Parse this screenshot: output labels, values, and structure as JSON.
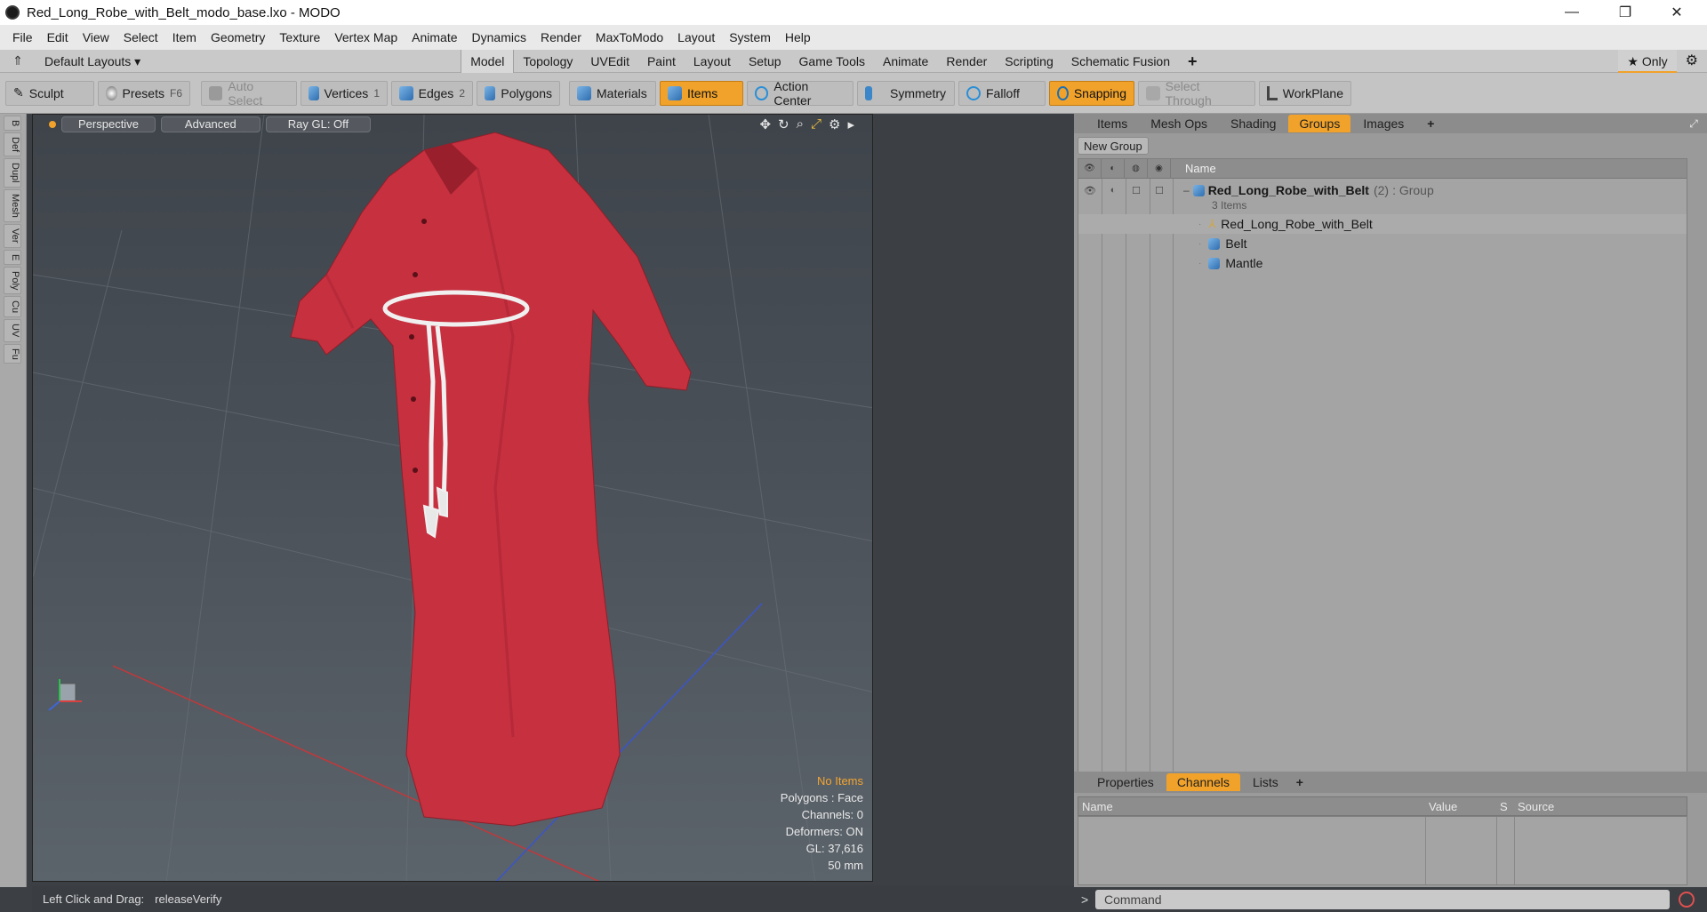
{
  "window": {
    "title": "Red_Long_Robe_with_Belt_modo_base.lxo - MODO",
    "minimize_glyph": "—",
    "restore_glyph": "❐",
    "close_glyph": "✕"
  },
  "menu": [
    "File",
    "Edit",
    "View",
    "Select",
    "Item",
    "Geometry",
    "Texture",
    "Vertex Map",
    "Animate",
    "Dynamics",
    "Render",
    "MaxToModo",
    "Layout",
    "System",
    "Help"
  ],
  "layoutbar": {
    "layouts_label": "Default Layouts ▾",
    "tabs": [
      "Model",
      "Topology",
      "UVEdit",
      "Paint",
      "Layout",
      "Setup",
      "Game Tools",
      "Animate",
      "Render",
      "Scripting",
      "Schematic Fusion"
    ],
    "active_tab": "Model",
    "add_glyph": "+",
    "only_label": "★ Only",
    "gear_glyph": "⚙"
  },
  "toolbar": {
    "sculpt": "Sculpt",
    "presets": "Presets",
    "presets_key": "F6",
    "auto_select": "Auto Select",
    "vertices": "Vertices",
    "vertices_num": "1",
    "edges": "Edges",
    "edges_num": "2",
    "polygons": "Polygons",
    "materials": "Materials",
    "items": "Items",
    "action_center": "Action Center",
    "symmetry": "Symmetry",
    "falloff": "Falloff",
    "snapping": "Snapping",
    "select_through": "Select Through",
    "workplane": "WorkPlane"
  },
  "left_strip": [
    "B",
    "Def",
    "Dupl",
    "Mesh",
    "Ver",
    "E",
    "Poly",
    "Cu",
    "UV",
    "Fu"
  ],
  "viewport": {
    "perspective": "Perspective",
    "advanced": "Advanced",
    "raygl": "Ray GL: Off",
    "info": {
      "no_items": "No Items",
      "polygons": "Polygons : Face",
      "channels": "Channels: 0",
      "deformers": "Deformers: ON",
      "gl": "GL: 37,616",
      "scale": "50 mm"
    }
  },
  "right_panel": {
    "tabs": [
      "Items",
      "Mesh Ops",
      "Shading",
      "Groups",
      "Images"
    ],
    "active_tab": "Groups",
    "add_glyph": "+",
    "new_group": "New Group",
    "name_header": "Name",
    "group": {
      "name": "Red_Long_Robe_with_Belt",
      "count": "(2)",
      "type": ": Group",
      "sub": "3 Items"
    },
    "items": [
      "Red_Long_Robe_with_Belt",
      "Belt",
      "Mantle"
    ]
  },
  "channels_panel": {
    "tabs": [
      "Properties",
      "Channels",
      "Lists"
    ],
    "active_tab": "Channels",
    "add_glyph": "+",
    "columns": [
      "Name",
      "Value",
      "S",
      "Source"
    ]
  },
  "status": {
    "label": "Left Click and Drag:",
    "value": "releaseVerify"
  },
  "command": {
    "prompt": ">",
    "placeholder": "Command"
  }
}
